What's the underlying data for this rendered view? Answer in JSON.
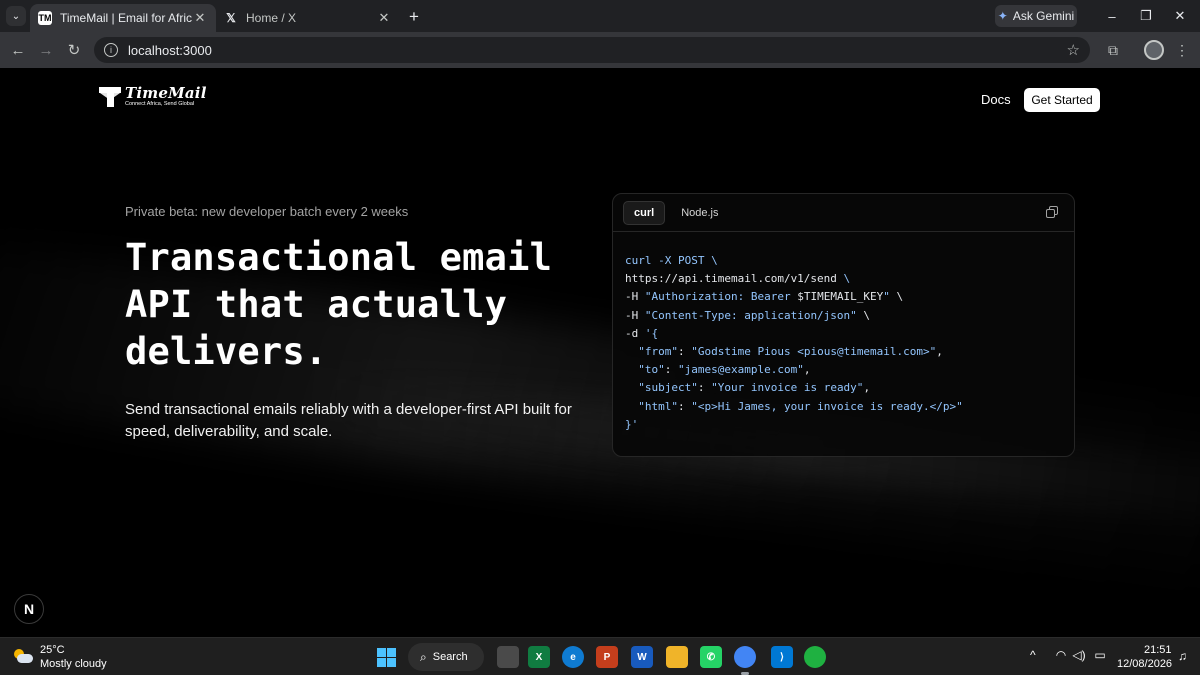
{
  "browser": {
    "tabs": [
      {
        "label": "TimeMail | Email for Africans",
        "favicon": "TM",
        "active": true
      },
      {
        "label": "Home / X",
        "favicon": "𝕏",
        "active": false
      }
    ],
    "new_tab": "+",
    "ask_gemini": "Ask Gemini",
    "url": "localhost:3000",
    "window_controls": {
      "minimize": "–",
      "restore": "❐",
      "close": "✕"
    }
  },
  "page": {
    "logo": {
      "name": "TimeMail",
      "tagline": "Connect Africa, Send Global"
    },
    "nav": {
      "docs": "Docs",
      "cta": "Get Started"
    },
    "hero": {
      "eyebrow": "Private beta: new developer batch every 2 weeks",
      "title": "Transactional email API that actually delivers.",
      "subtitle": "Send transactional emails reliably with a developer-first API built for speed, deliverability, and scale."
    },
    "code": {
      "tabs": [
        "curl",
        "Node.js"
      ],
      "active_tab": "curl",
      "lines": [
        [
          [
            "kw",
            "curl -X POST \\"
          ]
        ],
        [
          [
            "url",
            "https://api.timemail.com/v1/send "
          ],
          [
            "kw",
            "\\"
          ]
        ],
        [
          [
            "opt",
            "-H "
          ],
          [
            "str",
            "\"Authorization: Bearer "
          ],
          [
            "plain",
            "$TIMEMAIL_KEY"
          ],
          [
            "str",
            "\""
          ],
          [
            "plain",
            " \\"
          ]
        ],
        [
          [
            "opt",
            "-H "
          ],
          [
            "str",
            "\"Content-Type: application/json\""
          ],
          [
            "plain",
            " \\"
          ]
        ],
        [
          [
            "opt",
            "-d "
          ],
          [
            "str",
            "'{"
          ]
        ],
        [
          [
            "plain",
            "  "
          ],
          [
            "str",
            "\"from\""
          ],
          [
            "plain",
            ": "
          ],
          [
            "str",
            "\"Godstime Pious <pious@timemail.com>\""
          ],
          [
            "plain",
            ","
          ]
        ],
        [
          [
            "plain",
            "  "
          ],
          [
            "str",
            "\"to\""
          ],
          [
            "plain",
            ": "
          ],
          [
            "str",
            "\"james@example.com\""
          ],
          [
            "plain",
            ","
          ]
        ],
        [
          [
            "plain",
            "  "
          ],
          [
            "str",
            "\"subject\""
          ],
          [
            "plain",
            ": "
          ],
          [
            "str",
            "\"Your invoice is ready\""
          ],
          [
            "plain",
            ","
          ]
        ],
        [
          [
            "plain",
            "  "
          ],
          [
            "str",
            "\"html\""
          ],
          [
            "plain",
            ": "
          ],
          [
            "str",
            "\"<p>Hi James, your invoice is ready.</p>\""
          ]
        ],
        [
          [
            "str",
            "}'"
          ]
        ]
      ]
    },
    "dev_badge": "N"
  },
  "taskbar": {
    "weather": {
      "temp": "25°C",
      "condition": "Mostly cloudy"
    },
    "search_label": "Search",
    "apps": [
      {
        "name": "task-view",
        "label": "",
        "color": "#4a4a4a"
      },
      {
        "name": "excel",
        "label": "X",
        "color": "#107c41"
      },
      {
        "name": "edge",
        "label": "e",
        "color": "#0f7bd1"
      },
      {
        "name": "powerpoint",
        "label": "P",
        "color": "#c43e1c"
      },
      {
        "name": "word",
        "label": "W",
        "color": "#185abd"
      },
      {
        "name": "file-explorer",
        "label": "",
        "color": "#f0b429"
      },
      {
        "name": "whatsapp",
        "label": "✆",
        "color": "#25d366"
      },
      {
        "name": "chrome",
        "label": "",
        "color": "#4285f4"
      },
      {
        "name": "vscode",
        "label": "⟩",
        "color": "#0078d4"
      },
      {
        "name": "green-app",
        "label": "",
        "color": "#1fb141"
      }
    ],
    "time": "21:51",
    "date": "12/08/2026"
  }
}
